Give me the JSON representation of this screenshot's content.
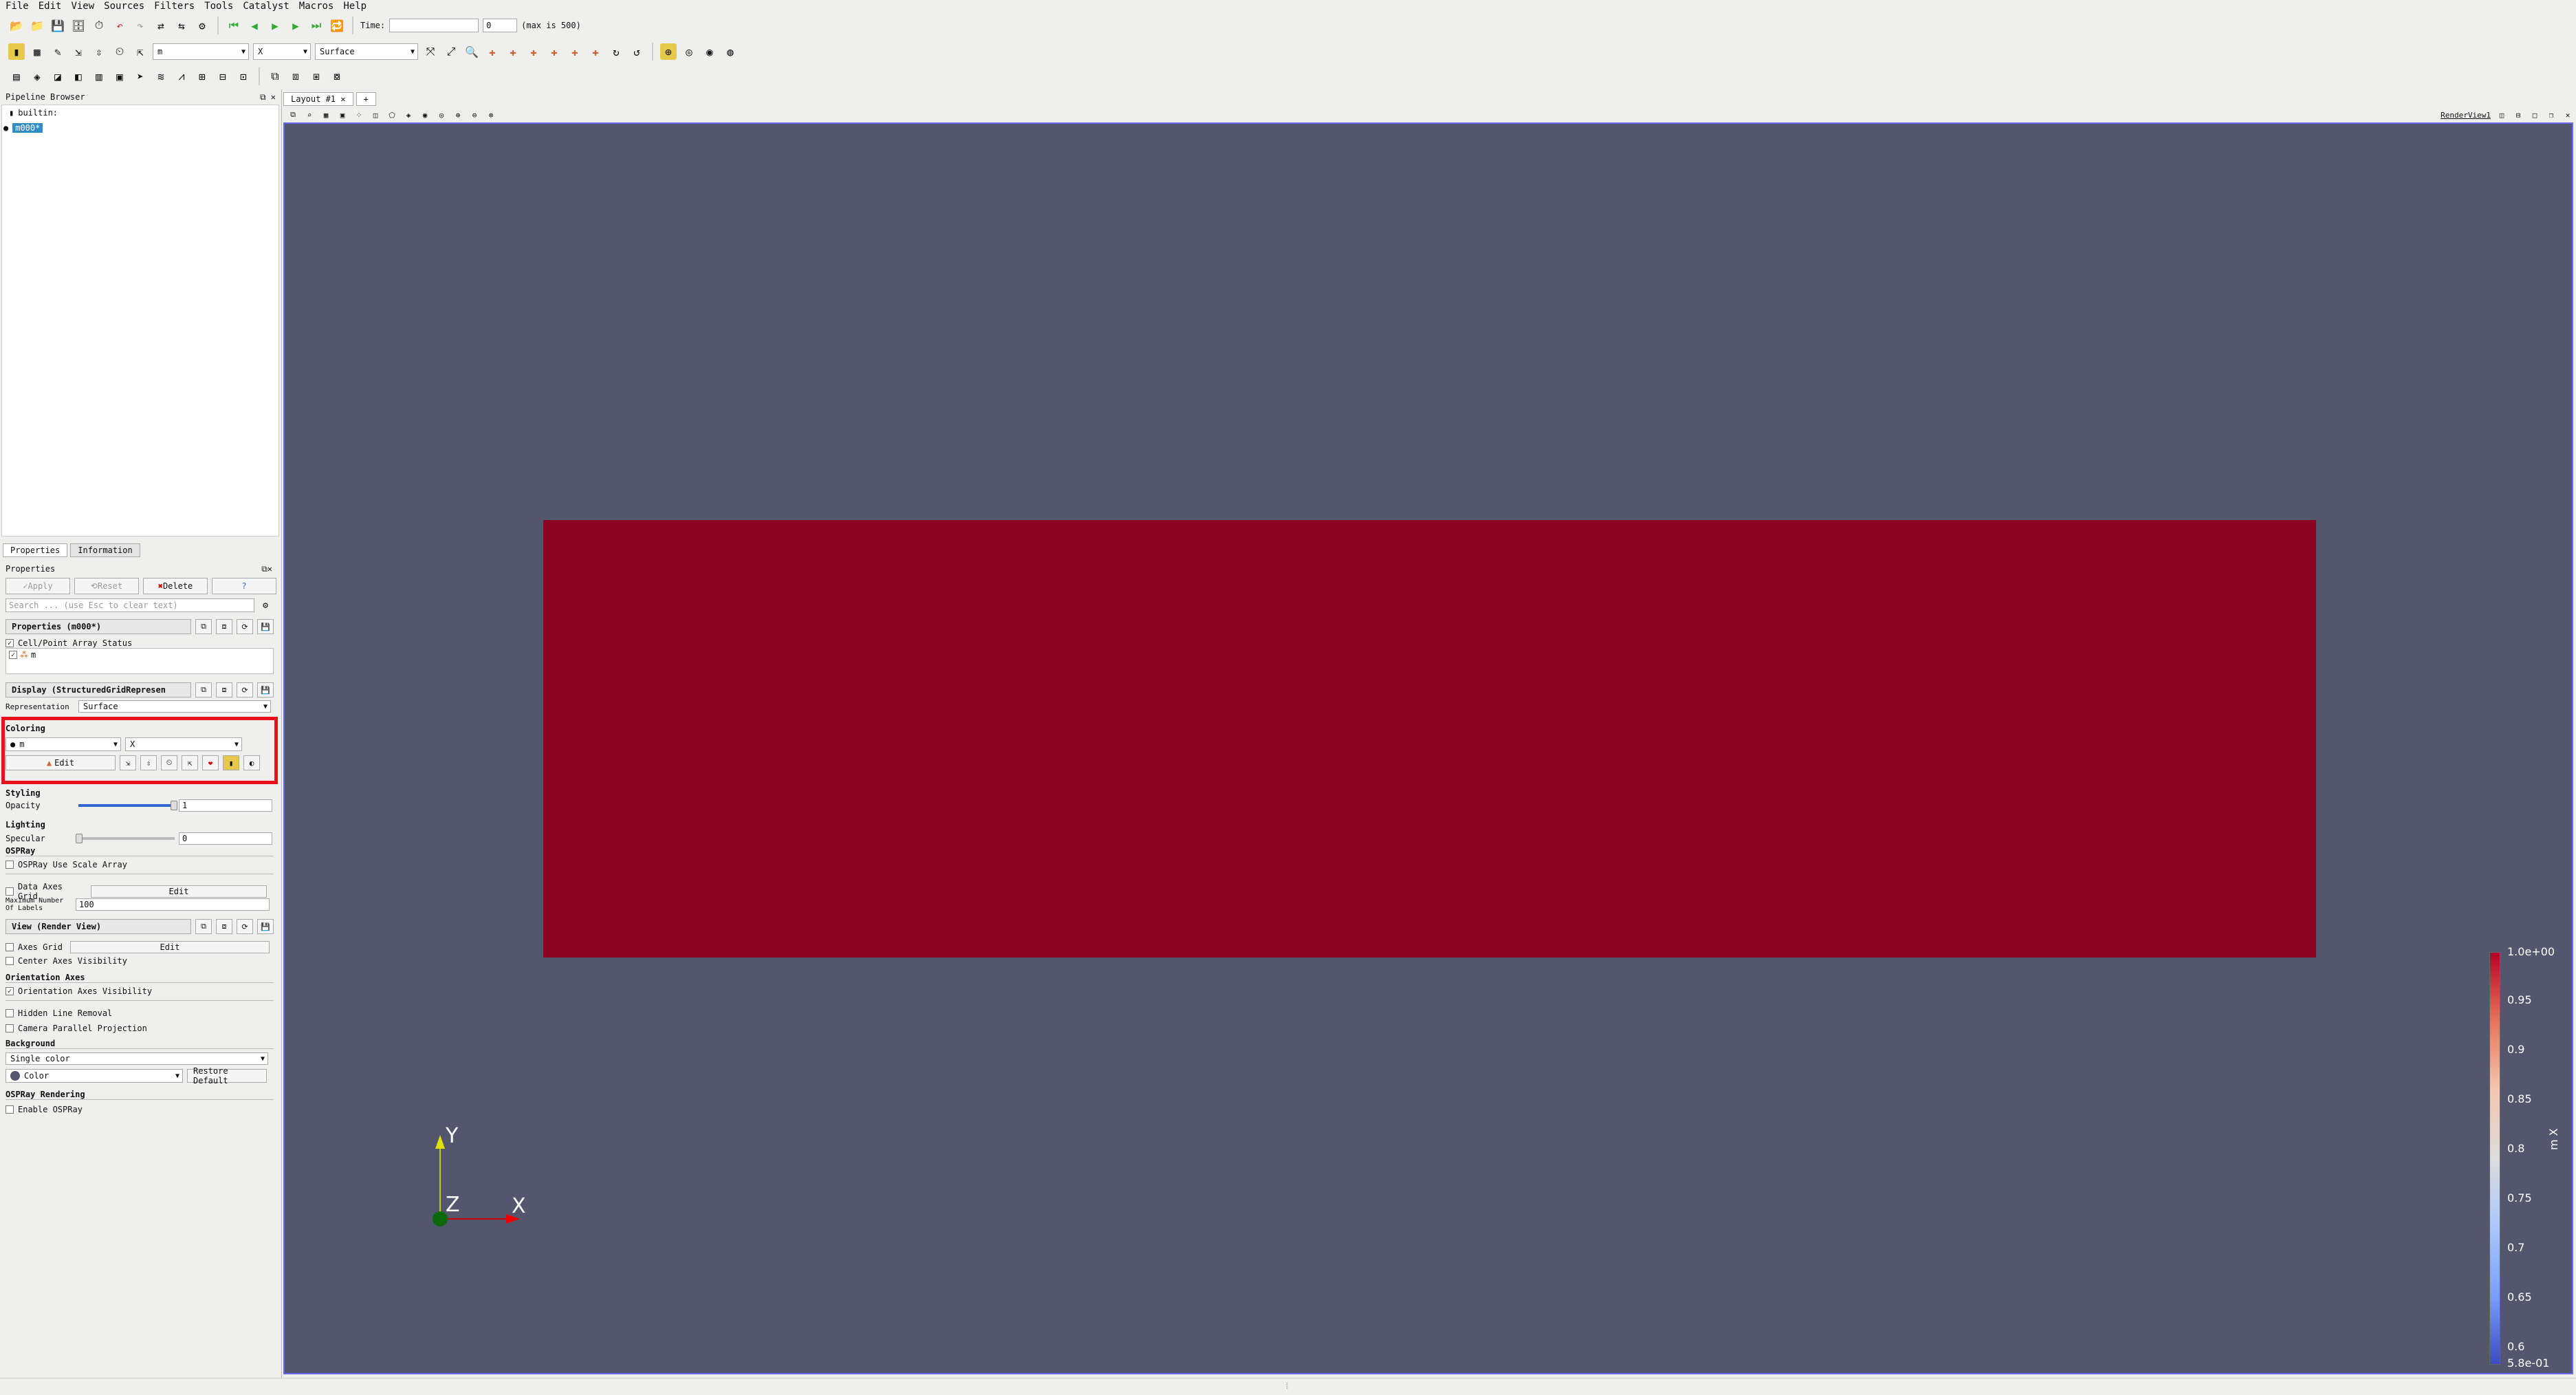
{
  "menubar": {
    "items": [
      "File",
      "Edit",
      "View",
      "Sources",
      "Filters",
      "Tools",
      "Catalyst",
      "Macros",
      "Help"
    ]
  },
  "toolbar1": {
    "time_label": "Time:",
    "time_value": "",
    "time_index": "0",
    "time_max": "(max is 500)"
  },
  "toolbar2": {
    "color_array": "m",
    "color_component": "X",
    "representation": "Surface"
  },
  "pipeline": {
    "title": "Pipeline Browser",
    "builtin": "builtin:",
    "source_name": "m000*"
  },
  "tabs": {
    "properties": "Properties",
    "information": "Information"
  },
  "properties": {
    "title": "Properties",
    "apply": "Apply",
    "reset": "Reset",
    "delete": "Delete",
    "help": "?",
    "search_placeholder": "Search ... (use Esc to clear text)",
    "section_properties": "Properties (m000*)",
    "array_status": "Cell/Point Array Status",
    "array_item": "m",
    "section_display": "Display (StructuredGridRepresen",
    "representation_label": "Representation",
    "representation_value": "Surface",
    "coloring_label": "Coloring",
    "coloring_array": "m",
    "coloring_component": "X",
    "edit_label": "Edit",
    "styling_label": "Styling",
    "opacity_label": "Opacity",
    "opacity_value": "1",
    "lighting_label": "Lighting",
    "specular_label": "Specular",
    "specular_value": "0",
    "ospray_label": "OSPRay",
    "ospray_scale": "OSPRay Use Scale Array",
    "data_axes_grid": "Data Axes Grid",
    "edit2": "Edit",
    "max_labels_1": "Maximum Number",
    "max_labels_2": "Of Labels",
    "max_labels_value": "100",
    "section_view": "View (Render View)",
    "axes_grid": "Axes Grid",
    "edit3": "Edit",
    "center_axes": "Center Axes Visibility",
    "orientation_axes_label": "Orientation Axes",
    "orientation_axes_vis": "Orientation Axes Visibility",
    "hidden_line": "Hidden Line Removal",
    "camera_parallel": "Camera Parallel Projection",
    "background_label": "Background",
    "background_value": "Single color",
    "color_label": "Color",
    "restore_default": "Restore Default",
    "ospray_rendering": "OSPRay Rendering",
    "enable_ospray": "Enable OSPRay"
  },
  "view": {
    "tab_label": "Layout #1",
    "add_tab": "+",
    "render_view_label": "RenderView1"
  },
  "axes": {
    "y": "Y",
    "z": "Z",
    "x": "X"
  },
  "legend": {
    "title": "m X",
    "max": "1.0e+00",
    "ticks": [
      "0.95",
      "0.9",
      "0.85",
      "0.8",
      "0.75",
      "0.7",
      "0.65",
      "0.6"
    ],
    "min": "5.8e-01"
  },
  "colors": {
    "background": "#52576e",
    "high": "#8a0424",
    "low": "#3b4cc0",
    "highlight": "#e8101c"
  }
}
